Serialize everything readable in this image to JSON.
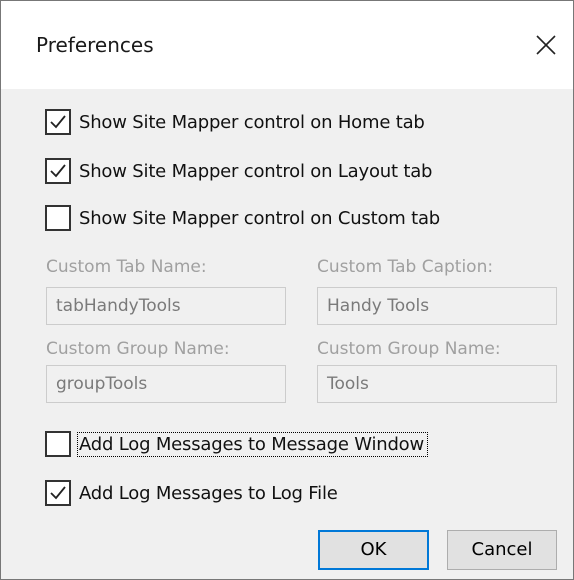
{
  "window": {
    "title": "Preferences",
    "close_icon": "close-icon"
  },
  "options": {
    "home_tab": {
      "label": "Show Site Mapper control on Home tab",
      "checked": true
    },
    "layout_tab": {
      "label": "Show Site Mapper control on Layout tab",
      "checked": true
    },
    "custom_tab": {
      "label": "Show Site Mapper control on Custom tab",
      "checked": false
    }
  },
  "custom": {
    "tab_name_label": "Custom Tab Name:",
    "tab_name_value": "tabHandyTools",
    "tab_caption_label": "Custom Tab Caption:",
    "tab_caption_value": "Handy Tools",
    "group_name_label": "Custom Group Name:",
    "group_name_value": "groupTools",
    "group_caption_label": "Custom Group Name:",
    "group_caption_value": "Tools"
  },
  "logging": {
    "message_window": {
      "label": "Add Log Messages to Message Window",
      "checked": false
    },
    "log_file": {
      "label": "Add Log Messages to Log File",
      "checked": true
    }
  },
  "buttons": {
    "ok": "OK",
    "cancel": "Cancel"
  },
  "colors": {
    "accent": "#0078d7",
    "disabled_text": "#a0a0a0",
    "dialog_bg": "#f0f0f0"
  }
}
